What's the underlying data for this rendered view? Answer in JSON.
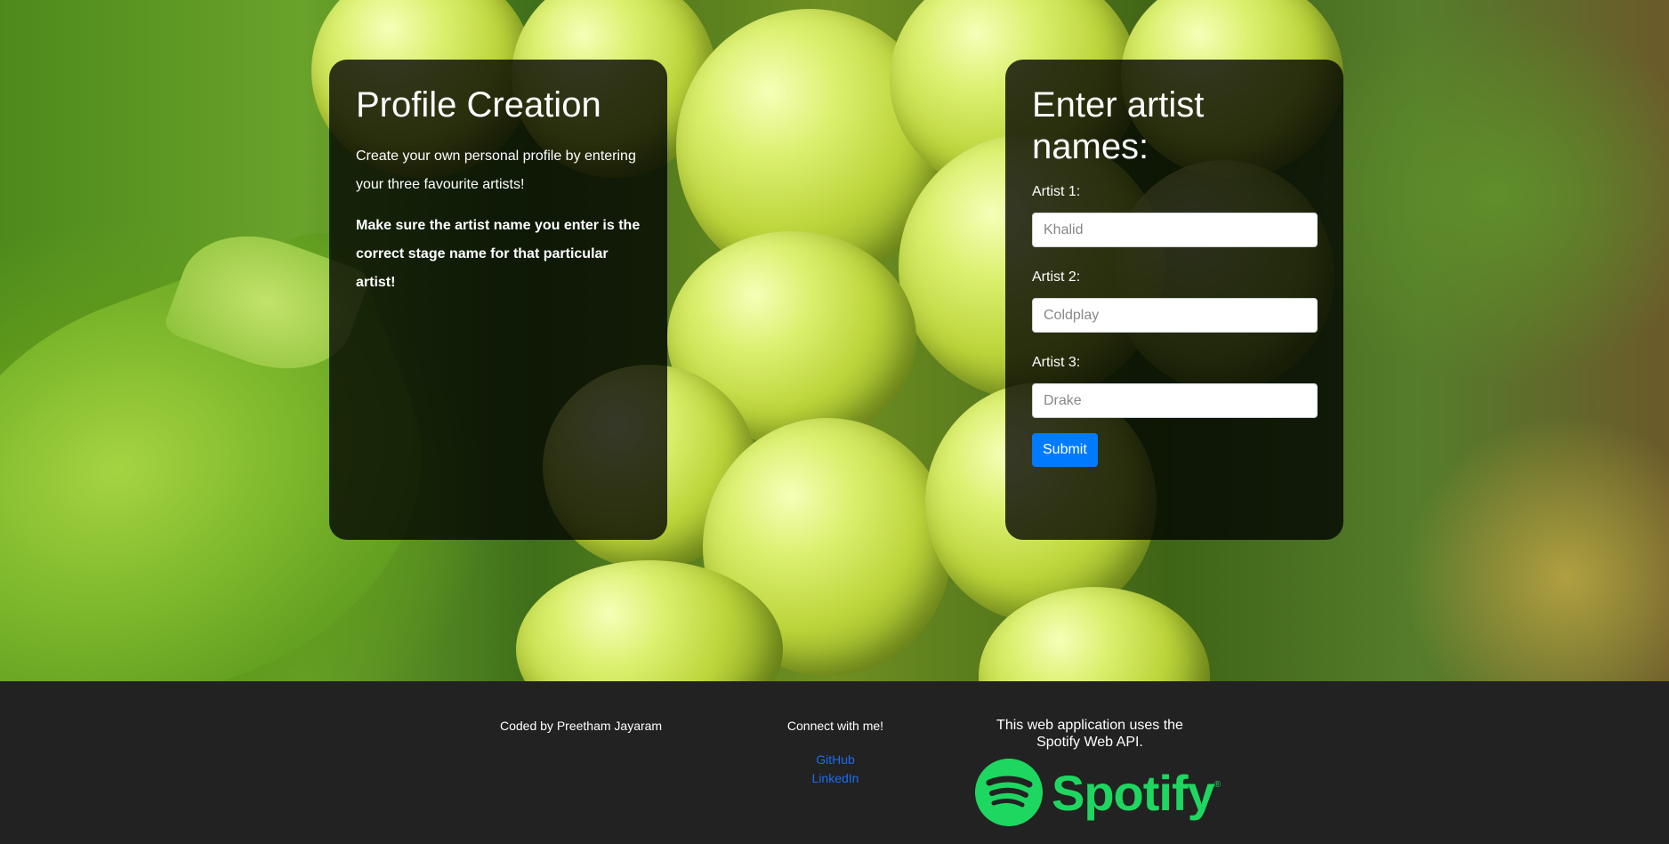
{
  "profile": {
    "title": "Profile Creation",
    "intro": "Create your own personal profile by entering your three favourite artists!",
    "note": "Make sure the artist name you enter is the correct stage name for that particular artist!"
  },
  "form": {
    "title": "Enter artist names:",
    "artists": [
      {
        "label": "Artist 1:",
        "placeholder": "Khalid"
      },
      {
        "label": "Artist 2:",
        "placeholder": "Coldplay"
      },
      {
        "label": "Artist 3:",
        "placeholder": "Drake"
      }
    ],
    "submit_label": "Submit"
  },
  "footer": {
    "credit": "Coded by Preetham Jayaram",
    "connect": "Connect with me!",
    "links": [
      "GitHub",
      "LinkedIn"
    ],
    "api_note": "This web application uses the Spotify Web API.",
    "logo_text": "Spotify",
    "logo_mark": "®"
  },
  "colors": {
    "submit": "#007bff",
    "link": "#1a6df0",
    "spotify_green": "#1ed760",
    "footer_bg": "#222222"
  }
}
